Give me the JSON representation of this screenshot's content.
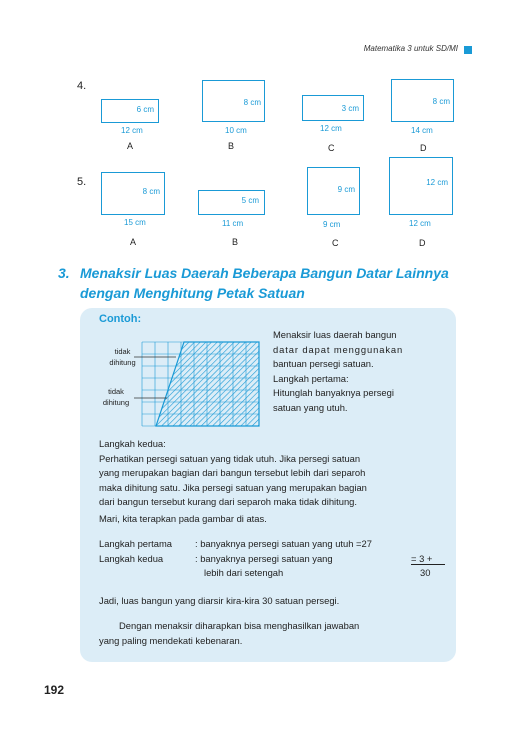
{
  "header": {
    "text": "Matematika 3 untuk SD/MI"
  },
  "row1": {
    "label": "4.",
    "shapes": [
      {
        "inside": "6 cm",
        "under": "12 cm",
        "letter": "A"
      },
      {
        "inside": "8 cm",
        "under": "10 cm",
        "letter": "B"
      },
      {
        "inside": "3 cm",
        "under": "12 cm",
        "letter": "C"
      },
      {
        "inside": "8 cm",
        "under": "14 cm",
        "letter": "D"
      }
    ]
  },
  "row2": {
    "label": "5.",
    "shapes": [
      {
        "inside": "8 cm",
        "under": "15 cm",
        "letter": "A"
      },
      {
        "inside": "5 cm",
        "under": "11 cm",
        "letter": "B"
      },
      {
        "inside": "9 cm",
        "under": "9 cm",
        "letter": "C"
      },
      {
        "inside": "12 cm",
        "under": "12 cm",
        "letter": "D"
      }
    ]
  },
  "section": {
    "number": "3.",
    "title_line1": "Menaksir Luas Daerah Beberapa Bangun Datar Lainnya",
    "title_line2": "dengan Menghitung Petak Satuan"
  },
  "example": {
    "heading": "Contoh:",
    "label_top_1": "tidak",
    "label_top_2": "dihitung",
    "label_bottom_1": "tidak",
    "label_bottom_2": "dihitung",
    "right_lines": [
      "Menaksir luas daerah bangun",
      "datar dapat menggunakan",
      "bantuan persegi satuan.",
      "Langkah pertama:",
      "Hitunglah banyaknya persegi",
      "satuan yang utuh."
    ],
    "step2_heading": "Langkah kedua:",
    "step2_lines": [
      "Perhatikan persegi satuan yang tidak utuh. Jika persegi satuan",
      "yang merupakan bagian dari bangun tersebut lebih dari separoh",
      "maka dihitung satu. Jika persegi satuan yang merupakan bagian",
      "dari bangun tersebut kurang dari separoh maka tidak dihitung."
    ],
    "apply": "Mari, kita terapkan pada gambar di atas.",
    "calc_l1_label": "Langkah pertama",
    "calc_l1_text": ": banyaknya persegi satuan yang utuh =27",
    "calc_l2_label": "Langkah kedua",
    "calc_l2_text": ": banyaknya persegi satuan yang",
    "calc_l2_value": "=  3 +",
    "calc_l3_text": "lebih dari setengah",
    "calc_total": "30",
    "conclusion": "Jadi, luas bangun yang diarsir kira-kira 30 satuan persegi.",
    "closing_line1": "Dengan menaksir diharapkan bisa menghasilkan jawaban",
    "closing_line2": "yang paling mendekati kebenaran."
  },
  "footer": {
    "page_number": "192"
  }
}
